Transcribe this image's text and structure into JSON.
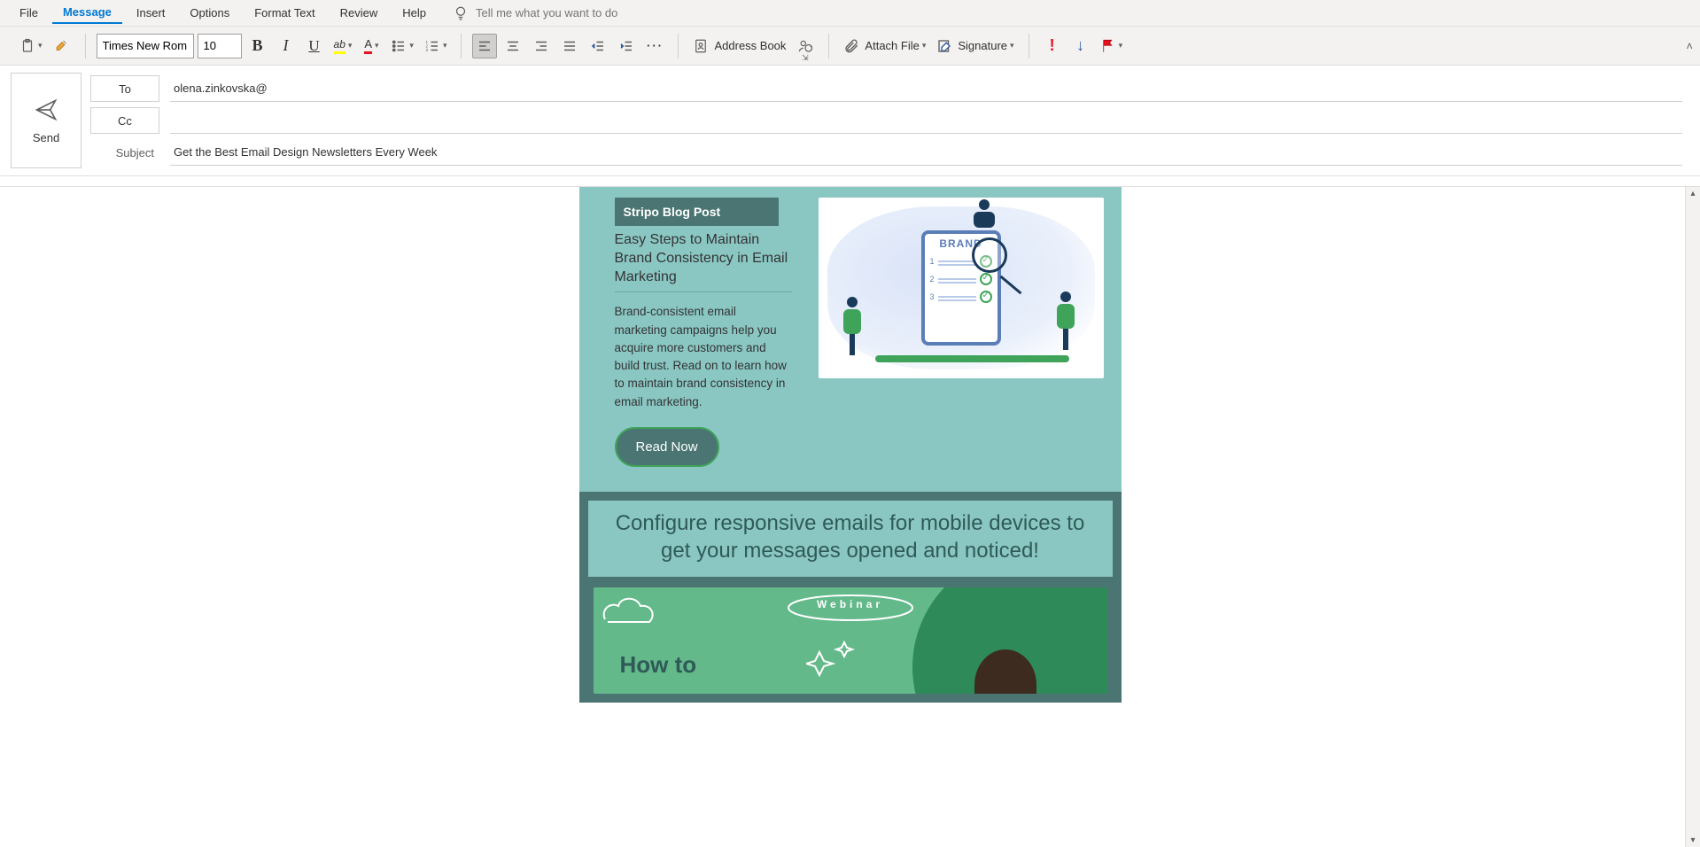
{
  "menu": {
    "file": "File",
    "message": "Message",
    "insert": "Insert",
    "options": "Options",
    "format_text": "Format Text",
    "review": "Review",
    "help": "Help",
    "tell_me_placeholder": "Tell me what you want to do"
  },
  "ribbon": {
    "font_name": "Times New Rom",
    "font_size": "10",
    "bold": "B",
    "italic": "I",
    "underline": "U",
    "highlight_letter": "ab",
    "fontcolor_letter": "A",
    "address_book": "Address Book",
    "attach_file": "Attach File",
    "signature": "Signature",
    "more": "···"
  },
  "header": {
    "send": "Send",
    "to_label": "To",
    "cc_label": "Cc",
    "subject_label": "Subject",
    "to_value": "olena.zinkovska@",
    "cc_value": "",
    "subject_value": "Get the Best Email Design Newsletters Every Week"
  },
  "email": {
    "block1": {
      "badge": "Stripo Blog Post",
      "title": "Easy Steps to Maintain Brand Consistency in Email Marketing",
      "desc": "Brand-consistent email marketing campaigns help you acquire more customers and build trust. Read on to learn how to maintain brand consistency in email marketing.",
      "button": "Read Now",
      "illus_board_title": "BRAND"
    },
    "block2": {
      "banner": "Configure responsive emails for mobile devices to get your messages opened and noticed!",
      "webinar_label": "Webinar",
      "howto": "How to"
    }
  }
}
